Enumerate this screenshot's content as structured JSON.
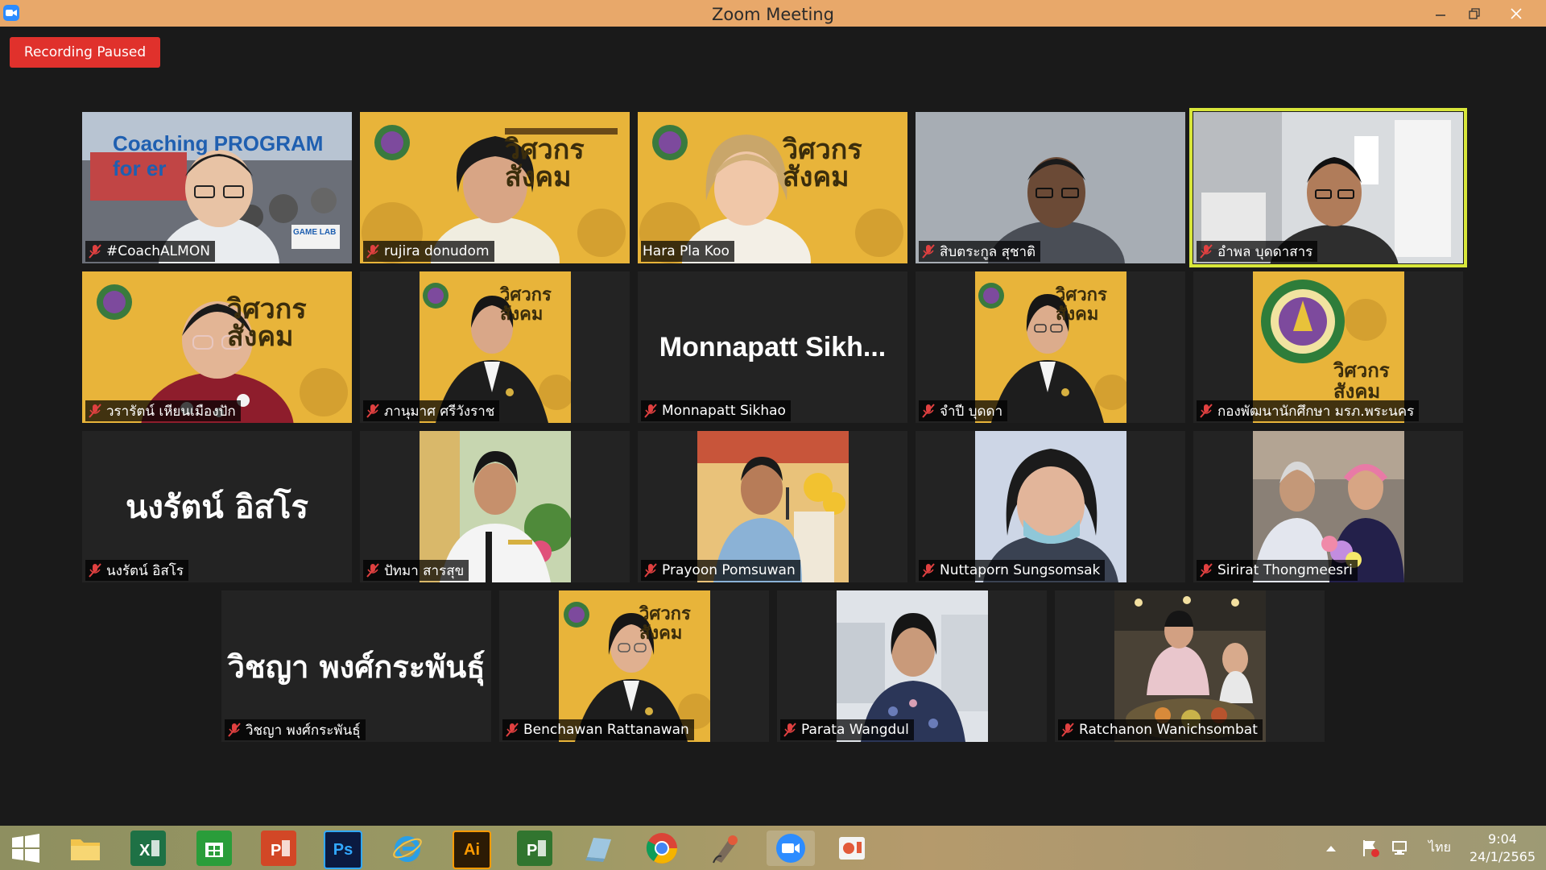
{
  "window": {
    "title": "Zoom Meeting"
  },
  "recording": {
    "label": "Recording Paused"
  },
  "participants": [
    {
      "name": "#CoachALMON",
      "muted": true
    },
    {
      "name": "rujira donudom",
      "muted": true
    },
    {
      "name": "Hara Pla Koo",
      "muted": false
    },
    {
      "name": "สิบตระกูล สุชาติ",
      "muted": true
    },
    {
      "name": "อำพล บุดดาสาร",
      "muted": true,
      "active_speaker": true
    },
    {
      "name": "วรารัตน์ เหียนเมืองปัก",
      "muted": true
    },
    {
      "name": "ภานุมาศ ศรีวังราช",
      "muted": true
    },
    {
      "name": "Monnapatt Sikhao",
      "muted": true,
      "display_text": "Monnapatt  Sikh..."
    },
    {
      "name": "จำปี บุดดา",
      "muted": true
    },
    {
      "name": "กองพัฒนานักศึกษา มรภ.พระนคร",
      "muted": true
    },
    {
      "name": "นงรัตน์ อิสโร",
      "muted": true,
      "display_text": "นงรัตน์ อิสโร"
    },
    {
      "name": "ปัทมา สารสุข",
      "muted": true
    },
    {
      "name": "Prayoon Pomsuwan",
      "muted": true
    },
    {
      "name": "Nuttaporn Sungsomsak",
      "muted": true
    },
    {
      "name": "Sirirat Thongmeesri",
      "muted": true
    },
    {
      "name": "วิชญา พงศ์กระพันธุ์",
      "muted": true,
      "display_text": "วิชญา พงศ์กระพันธุ์"
    },
    {
      "name": "Benchawan Rattanawan",
      "muted": true
    },
    {
      "name": "Parata Wangdul",
      "muted": true
    },
    {
      "name": "Ratchanon Wanichsombat",
      "muted": true
    }
  ],
  "backgrounds": {
    "coach_slide": "Coaching PROGRAM for er",
    "coach_logo": "GAME LAB",
    "banner": "วิศวกร สังคม"
  },
  "taskbar": {
    "apps": [
      "start-icon",
      "file-explorer-icon",
      "excel-icon",
      "store-icon",
      "powerpoint-icon",
      "photoshop-icon",
      "internet-explorer-icon",
      "illustrator-icon",
      "project-icon",
      "notepad-icon",
      "chrome-icon",
      "paint-icon",
      "zoom-icon",
      "slides-icon"
    ],
    "app_labels": {
      "photoshop": "Ps",
      "illustrator": "Ai"
    },
    "language": "ไทย",
    "time": "9:04",
    "date": "24/1/2565"
  },
  "colors": {
    "titlebar": "#e8a86a",
    "active_border": "#d8e63a",
    "recording": "#e0312c",
    "muted_icon": "#e04040"
  }
}
